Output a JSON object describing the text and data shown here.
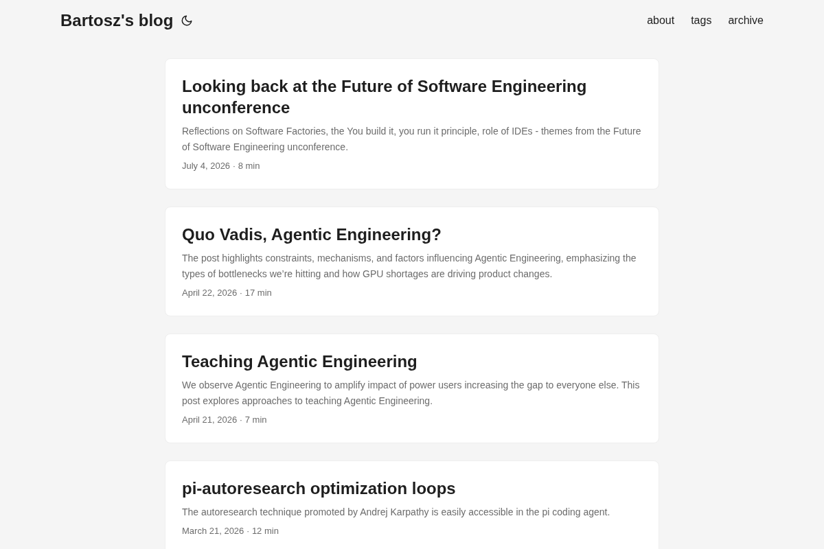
{
  "header": {
    "logo": "Bartosz's blog",
    "nav": [
      "about",
      "tags",
      "archive"
    ]
  },
  "posts": [
    {
      "title": "Looking back at the Future of Software Engineering unconference",
      "summary": "Reflections on Software Factories, the You build it, you run it principle, role of IDEs - themes from the Future of Software Engineering unconference.",
      "meta": "July 4, 2026 · 8 min"
    },
    {
      "title": "Quo Vadis, Agentic Engineering?",
      "summary": "The post highlights constraints, mechanisms, and factors influencing Agentic Engineering, emphasizing the types of bottlenecks we’re hitting and how GPU shortages are driving product changes.",
      "meta": "April 22, 2026 · 17 min"
    },
    {
      "title": "Teaching Agentic Engineering",
      "summary": "We observe Agentic Engineering to amplify impact of power users increasing the gap to everyone else. This post explores approaches to teaching Agentic Engineering.",
      "meta": "April 21, 2026 · 7 min"
    },
    {
      "title": "pi-autoresearch optimization loops",
      "summary": "The autoresearch technique promoted by Andrej Karpathy is easily accessible in the pi coding agent.",
      "meta": "March 21, 2026 · 12 min"
    }
  ]
}
